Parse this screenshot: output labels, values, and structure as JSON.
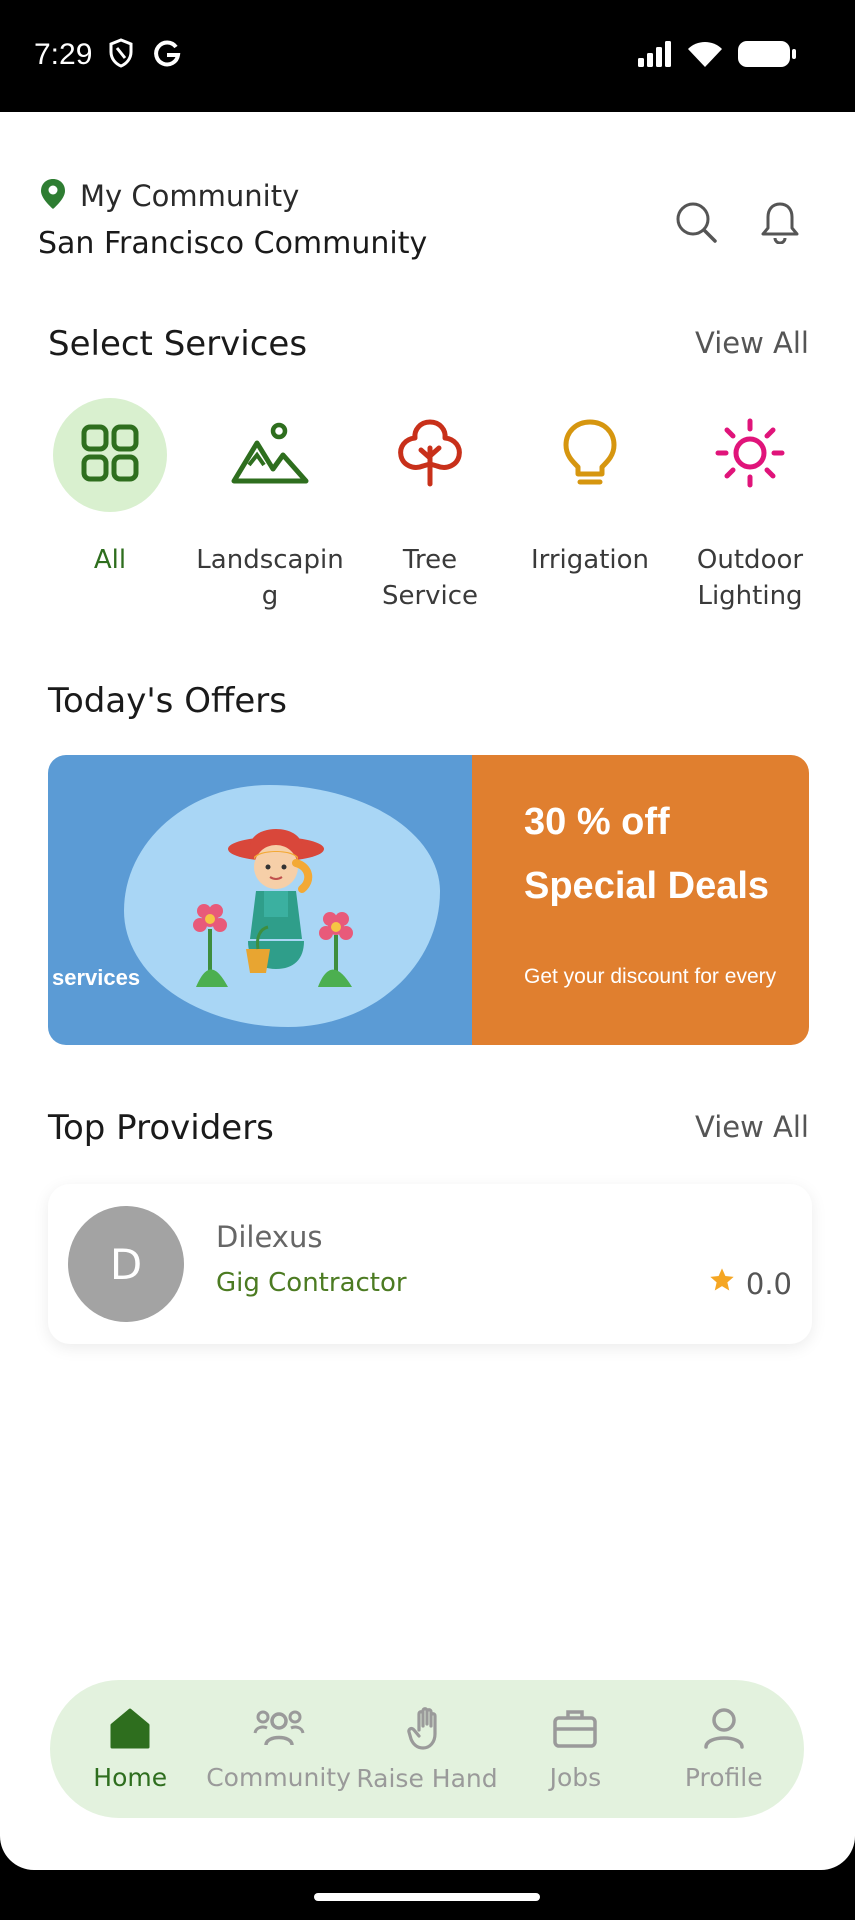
{
  "status_bar": {
    "time": "7:29",
    "icons": [
      "shield-icon",
      "google-icon",
      "signal-icon",
      "wifi-icon",
      "battery-icon"
    ]
  },
  "header": {
    "location_label": "My Community",
    "community_name": "San Francisco Community",
    "icons": [
      "location-pin-icon",
      "search-icon",
      "bell-icon"
    ]
  },
  "services_section": {
    "title": "Select Services",
    "view_all": "View All",
    "items": [
      {
        "label": "All",
        "icon": "grid-icon",
        "color": "#2e6e1e",
        "active": true
      },
      {
        "label": "Landscapin\ng",
        "icon": "mountain-icon",
        "color": "#2e6e1e",
        "active": false
      },
      {
        "label": "Tree\nService",
        "icon": "tree-icon",
        "color": "#c8301a",
        "active": false
      },
      {
        "label": "Irrigation",
        "icon": "lightbulb-icon",
        "color": "#d6960f",
        "active": false
      },
      {
        "label": "Outdoor\nLighting",
        "icon": "sun-icon",
        "color": "#e0147a",
        "active": false
      }
    ]
  },
  "offers_section": {
    "title": "Today's Offers",
    "banner": {
      "left_text": "services",
      "headline_1": "30 % off",
      "headline_2": "Special Deals",
      "subtext": "Get your discount for every"
    }
  },
  "providers_section": {
    "title": "Top Providers",
    "view_all": "View All",
    "providers": [
      {
        "initial": "D",
        "name": "Dilexus",
        "role": "Gig Contractor",
        "rating": "0.0"
      }
    ]
  },
  "bottom_nav": {
    "items": [
      {
        "label": "Home",
        "icon": "home-icon",
        "active": true
      },
      {
        "label": "Community",
        "icon": "people-icon",
        "active": false
      },
      {
        "label": "Raise Hand",
        "icon": "hand-icon",
        "active": false
      },
      {
        "label": "Jobs",
        "icon": "briefcase-icon",
        "active": false
      },
      {
        "label": "Profile",
        "icon": "person-icon",
        "active": false
      }
    ]
  },
  "colors": {
    "brand_green": "#2e6e1e",
    "nav_background": "#e3f2de",
    "banner_blue": "#5b9bd5",
    "banner_orange": "#e07f2f",
    "star": "#f5a623"
  }
}
